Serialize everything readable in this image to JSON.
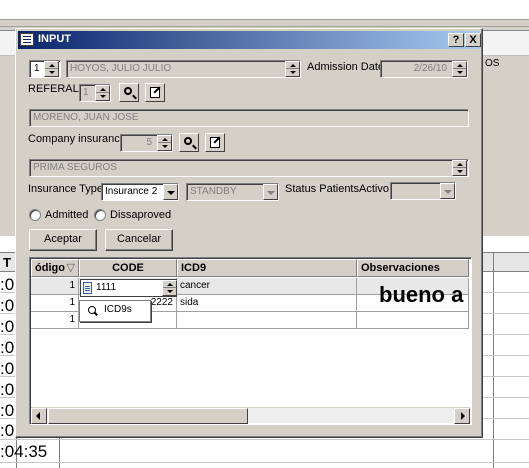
{
  "background": {
    "side_text": "OS",
    "grid_column_first_header": "T",
    "time_fragments": [
      ":0",
      ":0",
      ":0",
      ":0",
      ":0",
      ":0",
      ":0",
      ":0"
    ],
    "bottom_time": ":04:35"
  },
  "dialog": {
    "title": "INPUT",
    "help_button": "?",
    "close_button": "X",
    "patient": {
      "index_value": "1",
      "name": "HOYOS, JULIO JULIO",
      "admission_date_label": "Admission Date",
      "admission_date_value": "2/26/10"
    },
    "referral": {
      "label": "REFERALL",
      "value": "1",
      "doctor_name": "MORENO, JUAN JOSE"
    },
    "company": {
      "label": "Company insurance",
      "value": "5",
      "name": "PRIMA SEGUROS"
    },
    "insurance_type": {
      "label": "Insurance Type",
      "selected": "Insurance 2",
      "standby_value": "STANDBY"
    },
    "status_patients": {
      "label": "Status Patients",
      "value": "Activo"
    },
    "radios": {
      "admitted": "Admitted",
      "disapproved": "Dissaproved"
    },
    "buttons": {
      "accept": "Aceptar",
      "cancel": "Cancelar"
    },
    "grid": {
      "columns": [
        "ódigo",
        "CODE",
        "ICD9",
        "Observaciones"
      ],
      "rows": [
        {
          "codigo": "1",
          "code": "1111",
          "icd9": "cancer",
          "obs": ""
        },
        {
          "codigo": "1",
          "code": "2222",
          "icd9": "sida",
          "obs": ""
        },
        {
          "codigo": "1",
          "code": "",
          "icd9": "",
          "obs": ""
        }
      ],
      "overflow_text": "bueno a"
    },
    "popup": {
      "item": "ICD9s"
    }
  }
}
